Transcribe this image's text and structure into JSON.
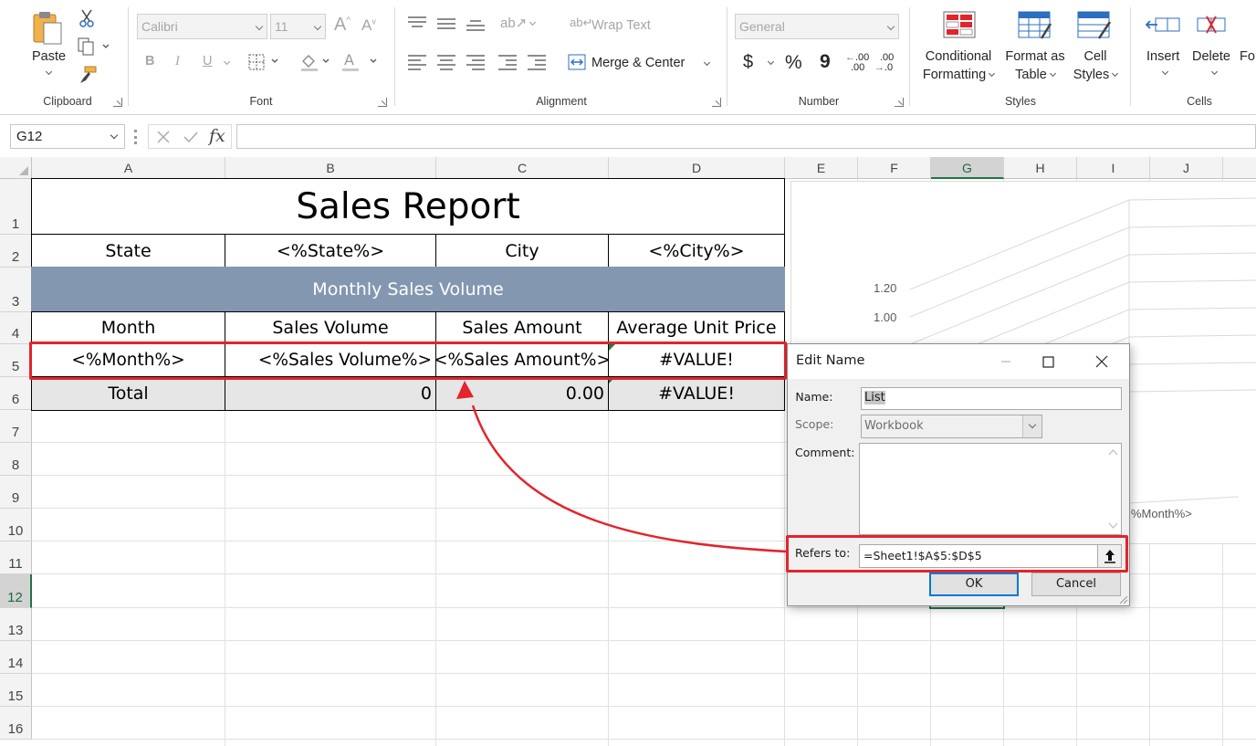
{
  "ribbon": {
    "clipboard": {
      "label": "Clipboard",
      "paste": "Paste"
    },
    "font": {
      "label": "Font",
      "font_name": "Calibri",
      "font_size": "11",
      "bold": "B",
      "italic": "I",
      "underline": "U"
    },
    "alignment": {
      "label": "Alignment",
      "wrap_text": "Wrap Text",
      "merge_center": "Merge & Center"
    },
    "number": {
      "label": "Number",
      "format": "General",
      "currency": "$",
      "percent": "%",
      "comma": "9",
      "inc_dec": ".00",
      "dec_dec": ".00"
    },
    "styles": {
      "label": "Styles",
      "conditional_formatting": [
        "Conditional",
        "Formatting"
      ],
      "format_as_table": [
        "Format as",
        "Table"
      ],
      "cell_styles": [
        "Cell",
        "Styles"
      ]
    },
    "cells": {
      "label": "Cells",
      "insert": "Insert",
      "delete": "Delete",
      "format_partial": "Fo"
    }
  },
  "formula_bar": {
    "name_box": "G12",
    "fx": "fx",
    "formula": ""
  },
  "columns": [
    "A",
    "B",
    "C",
    "D",
    "E",
    "F",
    "G",
    "H",
    "I",
    "J"
  ],
  "selected_column": "G",
  "rows": [
    "1",
    "2",
    "3",
    "4",
    "5",
    "6",
    "7",
    "8",
    "9",
    "10",
    "11",
    "12",
    "13",
    "14",
    "15",
    "16"
  ],
  "selected_row": "12",
  "report": {
    "title": "Sales Report",
    "state_label": "State",
    "state_value": "<%State%>",
    "city_label": "City",
    "city_value": "<%City%>",
    "band": "Monthly Sales Volume",
    "headers": [
      "Month",
      "Sales Volume",
      "Sales Amount",
      "Average Unit Price"
    ],
    "data_row": [
      "<%Month%>",
      "<%Sales Volume%>",
      "<%Sales Amount%>",
      "#VALUE!"
    ],
    "total_row": [
      "Total",
      "0",
      "0.00",
      "#VALUE!"
    ]
  },
  "chart": {
    "y_ticks": [
      "1.20",
      "1.00"
    ],
    "x_label_partial": "%Month%>"
  },
  "dialog": {
    "title": "Edit Name",
    "name_label": "Name:",
    "name_value": "List",
    "scope_label": "Scope:",
    "scope_value": "Workbook",
    "comment_label": "Comment:",
    "comment_value": "",
    "refers_label": "Refers to:",
    "refers_value": "=Sheet1!$A$5:$D$5",
    "ok": "OK",
    "cancel": "Cancel"
  },
  "colors": {
    "band": "#8497b0",
    "annotation": "#e3242b",
    "selection": "#217346",
    "dialog_default": "#0078d7"
  }
}
